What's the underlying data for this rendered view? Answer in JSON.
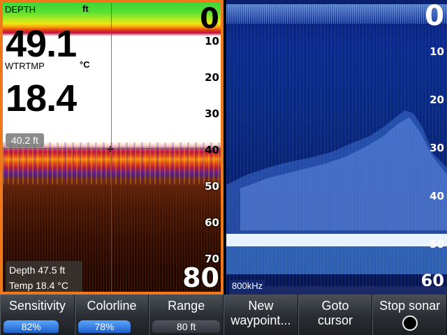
{
  "left_panel": {
    "depth_label": "DEPTH",
    "depth_unit": "ft",
    "depth_value": "49.1",
    "water_temp_label": "WTRTMP",
    "water_temp_unit": "°C",
    "water_temp_value": "18.4",
    "cursor_depth": "40.2 ft",
    "info_depth": "Depth 47.5  ft",
    "info_temp": "Temp  18.4 °C",
    "scale": [
      "0",
      "10",
      "20",
      "30",
      "40",
      "50",
      "60",
      "70",
      "80"
    ],
    "colors": {
      "border": "#f07818"
    }
  },
  "right_panel": {
    "frequency": "800kHz",
    "scale": [
      "0",
      "10",
      "20",
      "30",
      "40",
      "50",
      "60"
    ]
  },
  "softkeys": {
    "sensitivity": {
      "label": "Sensitivity",
      "value": "82%",
      "level": 0.82
    },
    "colorline": {
      "label": "Colorline",
      "value": "78%",
      "level": 0.78
    },
    "range": {
      "label": "Range",
      "value": "80 ft"
    },
    "new_waypoint": {
      "label": "New",
      "sub": "waypoint..."
    },
    "goto_cursor": {
      "label": "Goto",
      "sub": "cursor"
    },
    "stop_sonar": {
      "label": "Stop sonar"
    }
  }
}
